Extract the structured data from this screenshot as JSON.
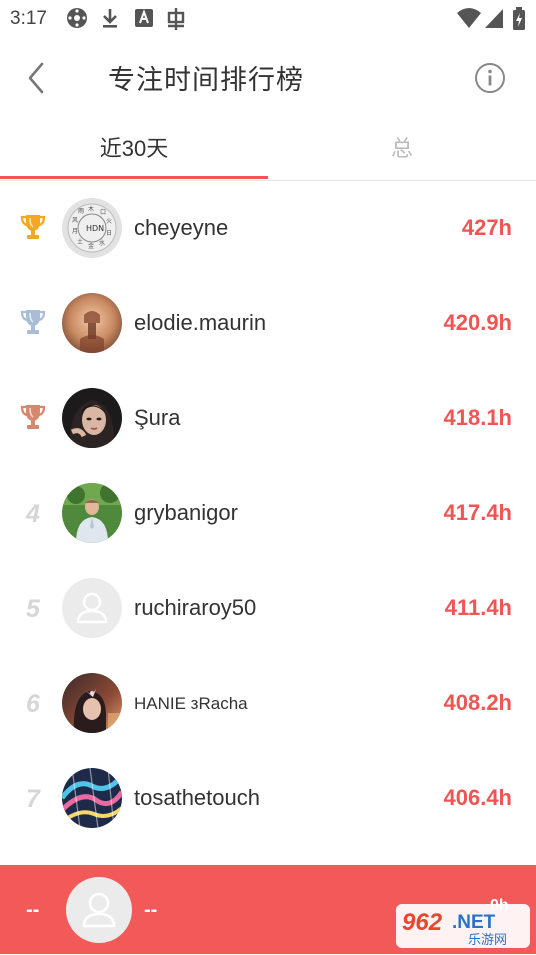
{
  "status_bar": {
    "time": "3:17",
    "icons": [
      "settings-dot-icon",
      "download-icon",
      "a-box-icon",
      "bug-icon",
      "wifi-icon",
      "signal-icon",
      "battery-charging-icon"
    ]
  },
  "header": {
    "title": "专注时间排行榜",
    "back_icon": "back-chevron-icon",
    "info_icon": "info-icon"
  },
  "tabs": [
    {
      "label": "近30天",
      "active": true
    },
    {
      "label": "总",
      "active": false
    }
  ],
  "colors": {
    "accent": "#f05454",
    "gold": "#f5a623",
    "silver": "#a9bdd6",
    "bronze": "#d7876b"
  },
  "ranking": [
    {
      "rank": "1",
      "trophy": "gold-trophy-icon",
      "name": "cheyeyne",
      "hours": "427h"
    },
    {
      "rank": "2",
      "trophy": "silver-trophy-icon",
      "name": "elodie.maurin",
      "hours": "420.9h"
    },
    {
      "rank": "3",
      "trophy": "bronze-trophy-icon",
      "name": "Şura",
      "hours": "418.1h"
    },
    {
      "rank": "4",
      "name": "grybanigor",
      "hours": "417.4h"
    },
    {
      "rank": "5",
      "name": "ruchiraroy50",
      "hours": "411.4h"
    },
    {
      "rank": "6",
      "name": "HANIE зRacha",
      "hours": "408.2h"
    },
    {
      "rank": "7",
      "name": "tosathetouch",
      "hours": "406.4h"
    }
  ],
  "me": {
    "rank": "--",
    "name": "--",
    "hours": "0h"
  },
  "watermark": {
    "brand": "962.NET",
    "sub": "乐游网"
  }
}
